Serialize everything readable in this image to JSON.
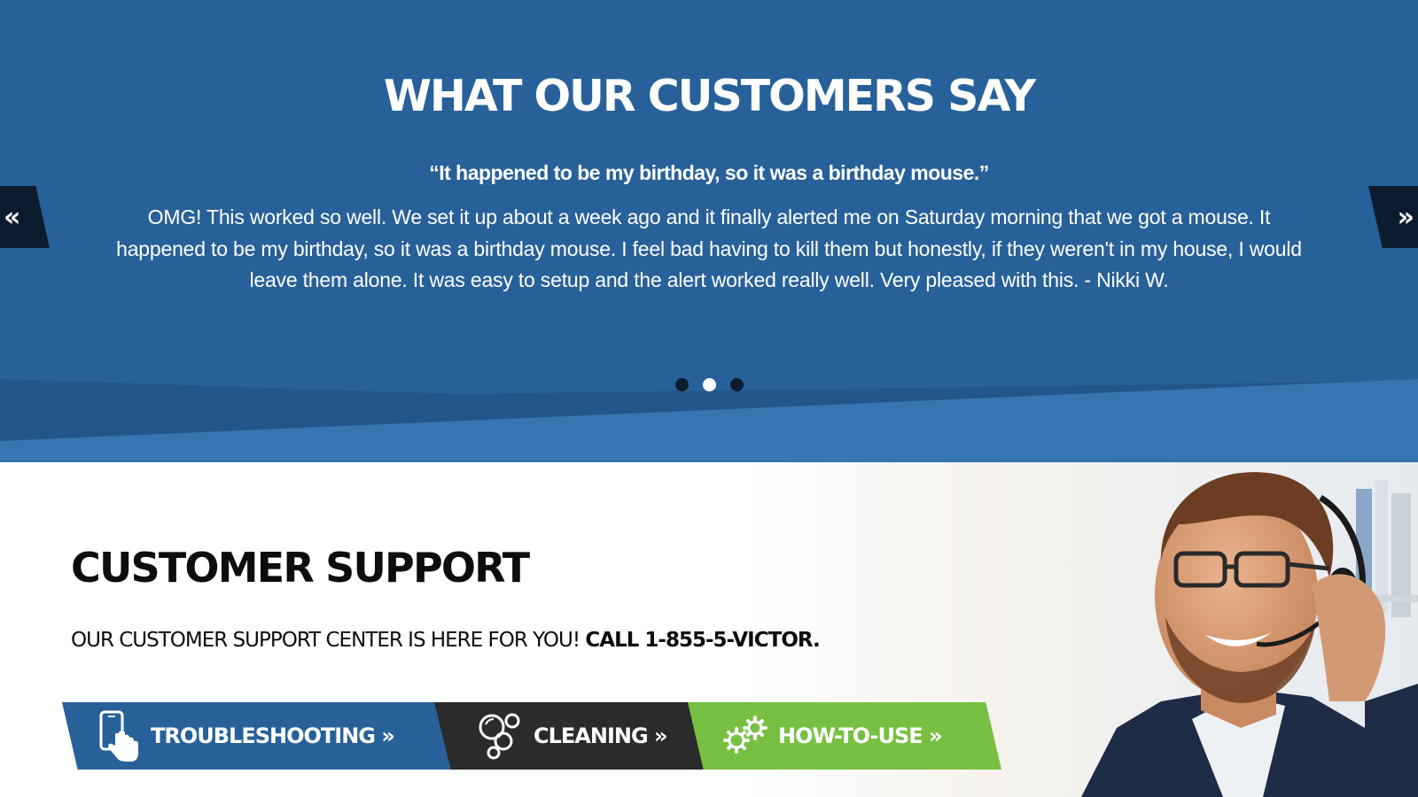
{
  "testimonials": {
    "title": "WHAT OUR CUSTOMERS SAY",
    "quote": "“It happened to be my birthday, so it was a birthday mouse.”",
    "body": "OMG! This worked so well. We set it up about a week ago and it finally alerted me on Saturday morning that we got a mouse. It happened to be my birthday, so it was a birthday mouse. I feel bad having to kill them but honestly, if they weren't in my house, I would leave them alone. It was easy to setup and the alert worked really well. Very pleased with this. - Nikki W.",
    "prev_label": "«",
    "next_label": "»",
    "dots": [
      {
        "active": false
      },
      {
        "active": true
      },
      {
        "active": false
      }
    ],
    "colors": {
      "background": "#286199",
      "band_dark": "#22568a",
      "band_light": "#3675b0",
      "arrow_bg": "#0d1b2e"
    }
  },
  "support": {
    "title": "CUSTOMER SUPPORT",
    "subtitle_plain": "OUR CUSTOMER SUPPORT CENTER IS HERE FOR YOU! ",
    "subtitle_bold": "CALL 1-855-5-VICTOR.",
    "buttons": [
      {
        "label": "TROUBLESHOOTING »",
        "icon": "phone-tap-icon",
        "color": "#286199"
      },
      {
        "label": "CLEANING »",
        "icon": "bubbles-icon",
        "color": "#2b2b2b"
      },
      {
        "label": "HOW-TO-USE »",
        "icon": "gears-icon",
        "color": "#77c042"
      }
    ],
    "photo_icon": "support-agent-photo"
  }
}
